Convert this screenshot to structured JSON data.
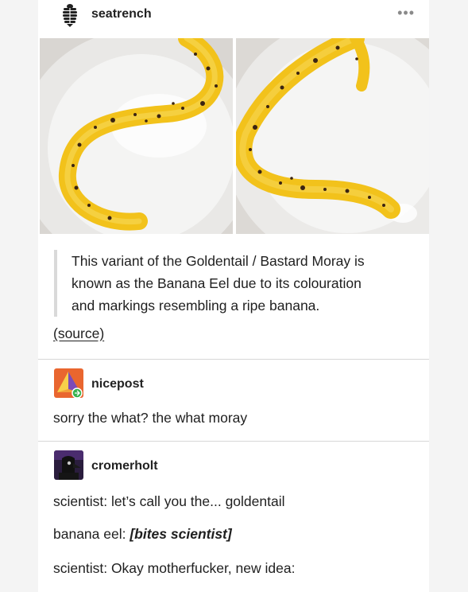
{
  "post": {
    "author": "seatrench",
    "more_label": "•••",
    "quote_lines": [
      "This variant of the Goldentail / Bastard Moray is",
      "known as the Banana Eel due to its colouration",
      "and markings resembling a ripe banana."
    ],
    "source_label": "(source)",
    "images": [
      {
        "description_icon": "banana-eel-photo"
      },
      {
        "description_icon": "banana-eel-photo"
      }
    ]
  },
  "reblogs": [
    {
      "username": "nicepost",
      "avatar_icon": "pyramid-avatar",
      "badge_icon": "reblog-badge-icon",
      "lines": [
        "sorry the what? the what moray"
      ]
    },
    {
      "username": "cromerholt",
      "avatar_icon": "plague-doctor-avatar",
      "lines": [
        {
          "prefix": "scientist: let’s call you the... goldentail",
          "emphasis": ""
        },
        {
          "prefix": "banana eel: ",
          "emphasis": "[bites scientist]"
        },
        {
          "prefix": "scientist: Okay motherfucker, new idea:",
          "emphasis": ""
        }
      ]
    }
  ],
  "colors": {
    "eel_yellow": "#f2c21b",
    "eel_spot": "#3b2412",
    "dish_white": "#eeeeee",
    "reblog_green": "#37b24d"
  }
}
